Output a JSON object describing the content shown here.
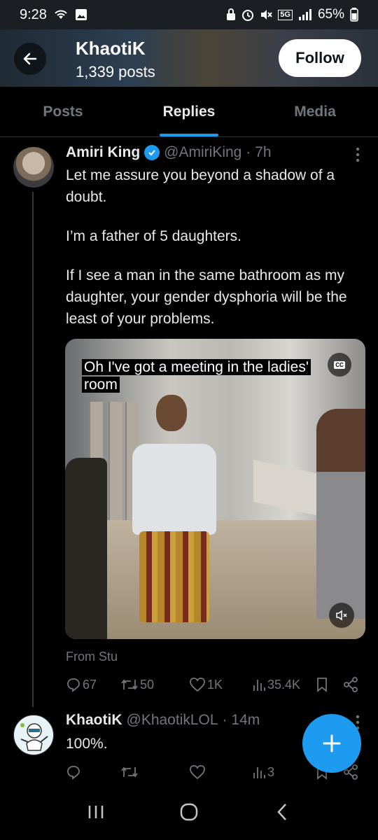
{
  "status_bar": {
    "time": "9:28",
    "network": "5G",
    "battery": "65%"
  },
  "profile_header": {
    "title": "KhaotiK",
    "posts_count": "1,339 posts",
    "follow_label": "Follow"
  },
  "tabs": [
    {
      "label": "Posts",
      "active": false
    },
    {
      "label": "Replies",
      "active": true
    },
    {
      "label": "Media",
      "active": false
    }
  ],
  "tweets": [
    {
      "name": "Amiri King",
      "handle": "@AmiriKing",
      "time": "· 7h",
      "verified": true,
      "paragraphs": [
        "Let me assure you beyond a shadow of a doubt.",
        "I’m a father of 5 daughters.",
        "If I see a man in the same bathroom as my daughter, your gender dysphoria will be the least of your problems."
      ],
      "media": {
        "caption_line1": "Oh I've got a meeting in the ladies'",
        "caption_line2": "room",
        "cc_label": "CC"
      },
      "from_label": "From Stu",
      "stats": {
        "replies": "67",
        "reposts": "50",
        "likes": "1K",
        "views": "35.4K"
      }
    },
    {
      "name": "KhaotiK",
      "handle": "@KhaotikLOL",
      "time": "· 14m",
      "verified": false,
      "paragraphs": [
        "100%."
      ],
      "stats": {
        "replies": "",
        "reposts": "",
        "likes": "",
        "views": "3"
      }
    }
  ],
  "colors": {
    "accent": "#1d9bf0",
    "muted": "#71767b",
    "text": "#e7e9ea",
    "background": "#000000"
  },
  "icons": [
    "back-arrow-icon",
    "verified-badge-icon",
    "more-icon",
    "reply-icon",
    "retweet-icon",
    "like-icon",
    "views-icon",
    "bookmark-icon",
    "share-icon",
    "compose-plus-icon",
    "cc-icon",
    "mute-icon",
    "recents-icon",
    "home-icon",
    "back-icon"
  ]
}
